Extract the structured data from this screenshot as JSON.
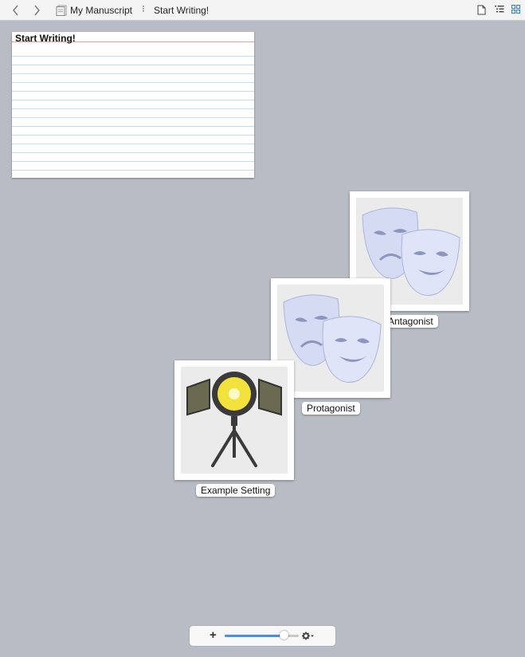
{
  "header": {
    "back_icon": "chevron-left-icon",
    "forward_icon": "chevron-right-icon",
    "document_icon": "manuscript-icon",
    "breadcrumb": [
      "My Manuscript",
      "Start Writing!"
    ],
    "separator": "⁝",
    "view_buttons": [
      "single-document-icon",
      "outline-icon",
      "corkboard-icon"
    ],
    "active_view_color": "#2a7fd4"
  },
  "card": {
    "title": "Start Writing!"
  },
  "tiles": [
    {
      "label": "Antagonist",
      "icon": "theater-masks-icon"
    },
    {
      "label": "Protagonist",
      "icon": "theater-masks-icon"
    },
    {
      "label": "Example Setting",
      "icon": "spotlight-icon"
    }
  ],
  "bottom_bar": {
    "plus_label": "+",
    "zoom_fraction": 0.8,
    "gear_icon": "gear-icon"
  }
}
